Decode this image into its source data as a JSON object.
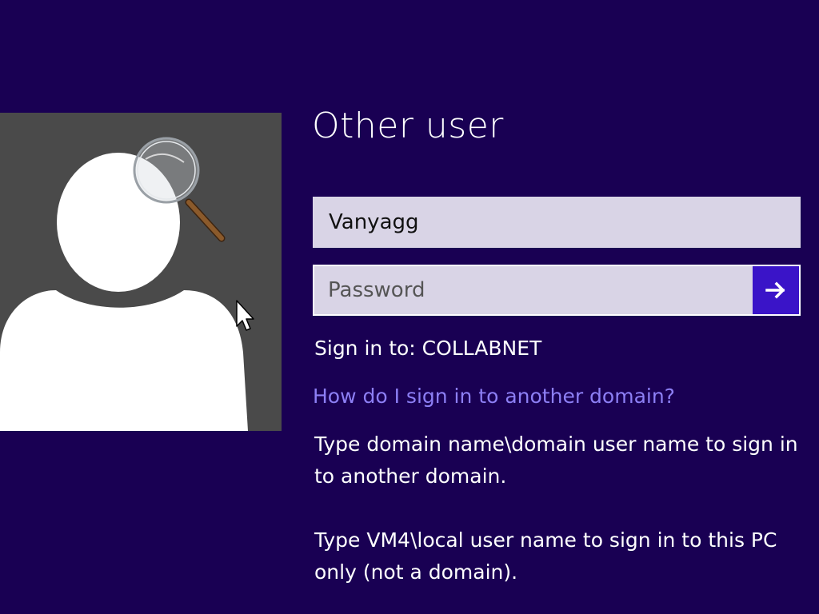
{
  "login": {
    "title": "Other user",
    "username_value": "Vanyagg",
    "password_placeholder": "Password",
    "submit_icon": "arrow-right-icon",
    "sign_in_to": "Sign in to: COLLABNET",
    "domain_help_link": "How do I sign in to another domain?",
    "help_text_1": "Type domain name\\domain user name to sign in to another domain.",
    "help_text_2": "Type VM4\\local user name to sign in to this PC only (not a domain)."
  },
  "avatar": {
    "icon": "user-placeholder-icon",
    "overlay_icon": "magnifier-icon"
  },
  "colors": {
    "background": "#190053",
    "tile": "#4a4a4a",
    "field": "#d9d4e6",
    "submit": "#3a14c8",
    "link": "#8d7ff5"
  }
}
